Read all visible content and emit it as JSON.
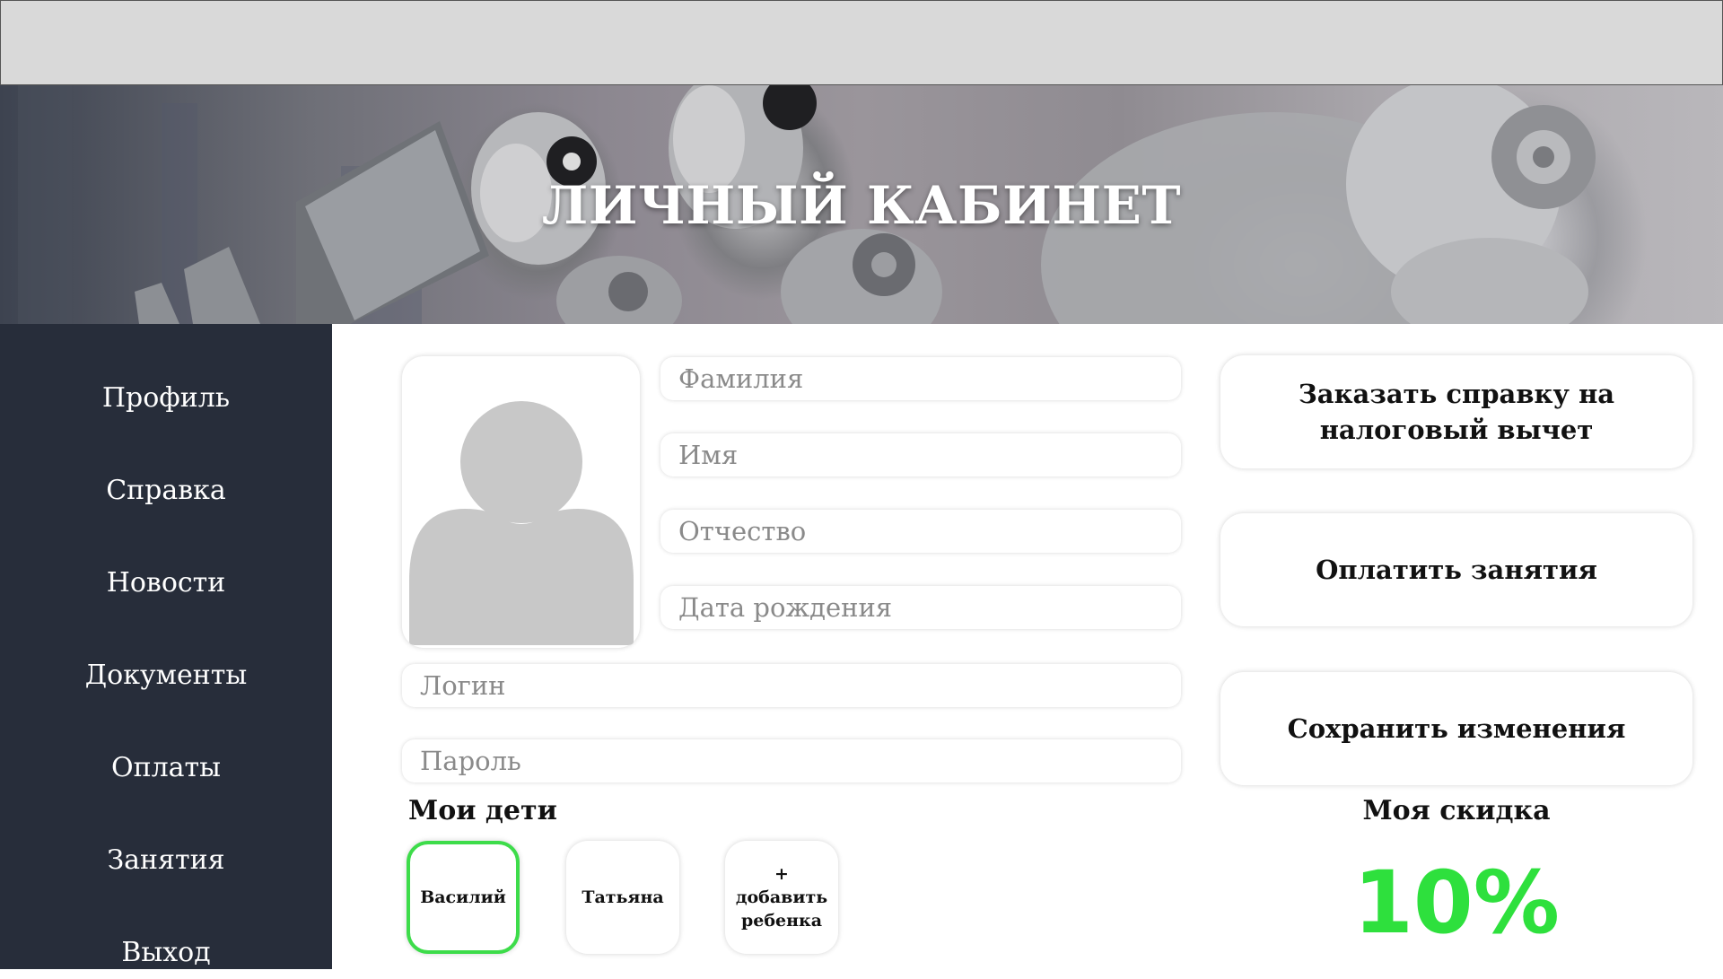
{
  "header": {
    "title": "ЛИЧНЫЙ КАБИНЕТ"
  },
  "sidebar": {
    "items": [
      {
        "label": "Профиль"
      },
      {
        "label": "Справка"
      },
      {
        "label": "Новости"
      },
      {
        "label": "Документы"
      },
      {
        "label": "Оплаты"
      },
      {
        "label": "Занятия"
      },
      {
        "label": "Выход"
      }
    ]
  },
  "profile": {
    "fields": {
      "last_name": {
        "placeholder": "Фамилия"
      },
      "first_name": {
        "placeholder": "Имя"
      },
      "middle_name": {
        "placeholder": "Отчество"
      },
      "birth_date": {
        "placeholder": "Дата рождения"
      },
      "login": {
        "placeholder": "Логин"
      },
      "password": {
        "placeholder": "Пароль"
      }
    }
  },
  "actions": {
    "tax_certificate": "Заказать справку на налоговый вычет",
    "pay_lessons": "Оплатить занятия",
    "save_changes": "Сохранить изменения"
  },
  "children": {
    "title": "Мои дети",
    "items": [
      {
        "name": "Василий",
        "selected": true
      },
      {
        "name": "Татьяна",
        "selected": false
      }
    ],
    "add_plus": "+",
    "add_label": "добавить ребенка"
  },
  "discount": {
    "title": "Моя скидка",
    "value": "10%"
  },
  "colors": {
    "sidebar_bg": "#272d3a",
    "accent_green": "#2ee03d",
    "topbar_bg": "#d9d9d9"
  }
}
